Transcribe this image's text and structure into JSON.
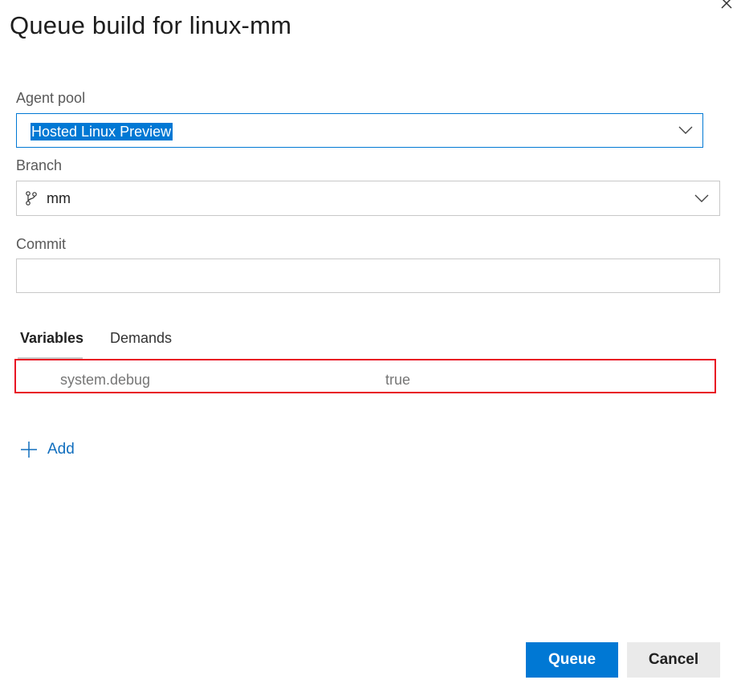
{
  "dialog": {
    "title": "Queue build for linux-mm",
    "close_icon": "close-icon"
  },
  "agent_pool": {
    "label": "Agent pool",
    "value": "Hosted Linux Preview",
    "icon": "chevron-down-icon"
  },
  "branch": {
    "label": "Branch",
    "value": "mm",
    "icons": [
      "branch-icon",
      "chevron-down-icon"
    ]
  },
  "commit": {
    "label": "Commit",
    "value": ""
  },
  "tabs": [
    {
      "label": "Variables",
      "active": true
    },
    {
      "label": "Demands",
      "active": false
    }
  ],
  "variables": [
    {
      "name": "system.debug",
      "value": "true"
    }
  ],
  "add": {
    "label": "Add",
    "icon": "plus-icon"
  },
  "buttons": {
    "queue": "Queue",
    "cancel": "Cancel"
  },
  "colors": {
    "accent": "#0078d4",
    "highlight_border": "#e81123",
    "link": "#106ebe"
  }
}
